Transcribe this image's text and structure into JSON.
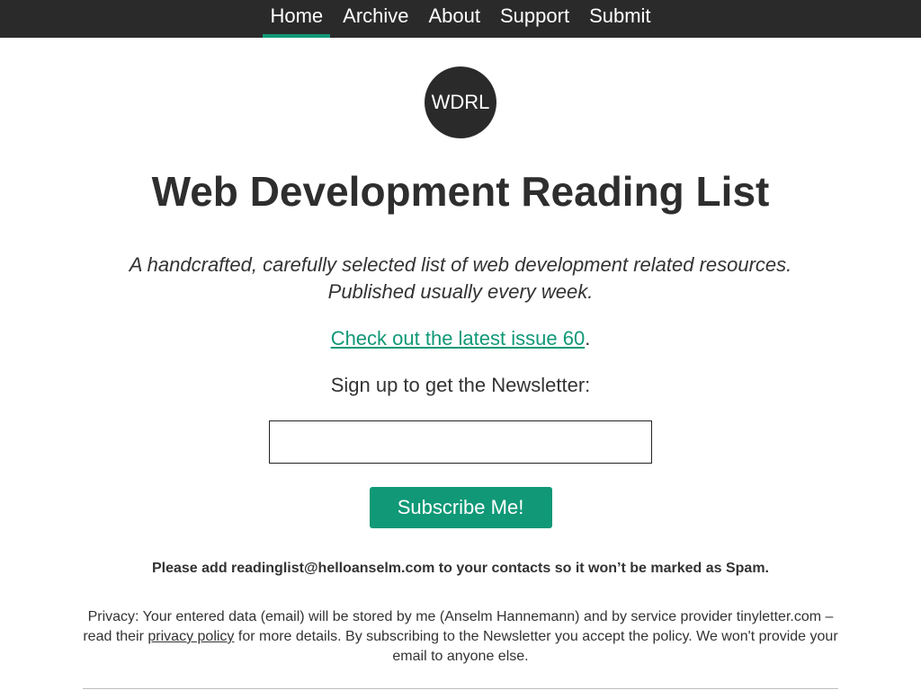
{
  "nav": {
    "items": [
      {
        "label": "Home",
        "active": true
      },
      {
        "label": "Archive",
        "active": false
      },
      {
        "label": "About",
        "active": false
      },
      {
        "label": "Support",
        "active": false
      },
      {
        "label": "Submit",
        "active": false
      }
    ]
  },
  "logo": {
    "text": "WDRL"
  },
  "page": {
    "title": "Web Development Reading List",
    "tagline_line1": "A handcrafted, carefully selected list of web development related resources.",
    "tagline_line2": "Published usually every week.",
    "latest_link": "Check out the latest issue 60",
    "latest_suffix": ".",
    "signup_label": "Sign up to get the Newsletter:"
  },
  "form": {
    "email_value": "",
    "email_placeholder": "",
    "subscribe_label": "Subscribe Me!"
  },
  "notes": {
    "spam": "Please add readinglist@helloanselm.com to your contacts so it won’t be marked as Spam.",
    "privacy_before": "Privacy: Your entered data (email) will be stored by me (Anselm Hannemann) and by service provider tinyletter.com – read their ",
    "privacy_link": "privacy policy",
    "privacy_after": " for more details. By subscribing to the Newsletter you accept the policy. We won't provide your email to anyone else."
  },
  "colors": {
    "accent": "#109877",
    "nav_bg": "#2a2a2a"
  }
}
